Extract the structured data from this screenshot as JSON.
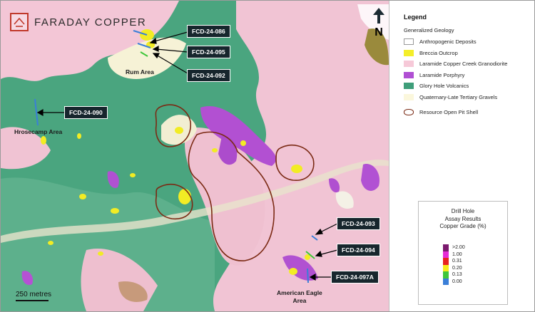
{
  "brand": {
    "name": "FARADAY COPPER",
    "logo_icon": "faraday-logo-icon"
  },
  "north_arrow": {
    "label": "N"
  },
  "scale_bar": {
    "label": "250 metres"
  },
  "drill_holes": [
    {
      "id": "FCD-24-086"
    },
    {
      "id": "FCD-24-095"
    },
    {
      "id": "FCD-24-092"
    },
    {
      "id": "FCD-24-090"
    },
    {
      "id": "FCD-24-093"
    },
    {
      "id": "FCD-24-094"
    },
    {
      "id": "FCD-24-097A"
    }
  ],
  "areas": [
    {
      "name": "Rum Area"
    },
    {
      "name": "Hrosecamp Area"
    },
    {
      "name": "American Eagle\nArea"
    }
  ],
  "legend": {
    "title": "Legend",
    "subtitle": "Generalized Geology",
    "items": [
      {
        "label": "Anthropogenic Deposits",
        "color": "#ffffff",
        "border": "#999999"
      },
      {
        "label": "Breccia Outcrop",
        "color": "#f4ee2a"
      },
      {
        "label": "Laramide Copper Creek Granodiorite",
        "color": "#f6c9d8"
      },
      {
        "label": "Laramide Porphyry",
        "color": "#b04fd3"
      },
      {
        "label": "Glory Hole Volcanics",
        "color": "#3f9e7a"
      },
      {
        "label": "Quaternary-Late Tertiary Gravels",
        "color": "#fbf7dc"
      }
    ],
    "pit_label": "Resource Open Pit Shell",
    "pit_color": "#7a2a14"
  },
  "grade_legend": {
    "title_lines": [
      "Drill Hole",
      "Assay Results",
      "Copper Grade (%)"
    ],
    "levels": [
      {
        "label": ">2.00",
        "color": "#7b1a6e"
      },
      {
        "label": "1.00",
        "color": "#e62bd6"
      },
      {
        "label": "0.31",
        "color": "#e8211f"
      },
      {
        "label": "0.20",
        "color": "#f7ea1d"
      },
      {
        "label": "0.13",
        "color": "#3fc63a"
      },
      {
        "label": "0.00",
        "color": "#3a7fd8"
      }
    ]
  }
}
